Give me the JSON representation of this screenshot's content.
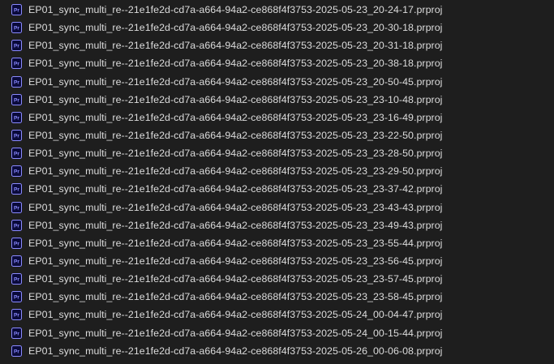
{
  "colors": {
    "background": "#1e1e1e",
    "text": "#dcdcdc",
    "icon_fill": "#0a0a3a",
    "icon_accent": "#8a8aff"
  },
  "icon": {
    "name": "premiere-pro-project-icon",
    "label": "Pr"
  },
  "files": [
    "EP01_sync_multi_re--21e1fe2d-cd7a-a664-94a2-ce868f4f3753-2025-05-23_20-24-17.prproj",
    "EP01_sync_multi_re--21e1fe2d-cd7a-a664-94a2-ce868f4f3753-2025-05-23_20-30-18.prproj",
    "EP01_sync_multi_re--21e1fe2d-cd7a-a664-94a2-ce868f4f3753-2025-05-23_20-31-18.prproj",
    "EP01_sync_multi_re--21e1fe2d-cd7a-a664-94a2-ce868f4f3753-2025-05-23_20-38-18.prproj",
    "EP01_sync_multi_re--21e1fe2d-cd7a-a664-94a2-ce868f4f3753-2025-05-23_20-50-45.prproj",
    "EP01_sync_multi_re--21e1fe2d-cd7a-a664-94a2-ce868f4f3753-2025-05-23_23-10-48.prproj",
    "EP01_sync_multi_re--21e1fe2d-cd7a-a664-94a2-ce868f4f3753-2025-05-23_23-16-49.prproj",
    "EP01_sync_multi_re--21e1fe2d-cd7a-a664-94a2-ce868f4f3753-2025-05-23_23-22-50.prproj",
    "EP01_sync_multi_re--21e1fe2d-cd7a-a664-94a2-ce868f4f3753-2025-05-23_23-28-50.prproj",
    "EP01_sync_multi_re--21e1fe2d-cd7a-a664-94a2-ce868f4f3753-2025-05-23_23-29-50.prproj",
    "EP01_sync_multi_re--21e1fe2d-cd7a-a664-94a2-ce868f4f3753-2025-05-23_23-37-42.prproj",
    "EP01_sync_multi_re--21e1fe2d-cd7a-a664-94a2-ce868f4f3753-2025-05-23_23-43-43.prproj",
    "EP01_sync_multi_re--21e1fe2d-cd7a-a664-94a2-ce868f4f3753-2025-05-23_23-49-43.prproj",
    "EP01_sync_multi_re--21e1fe2d-cd7a-a664-94a2-ce868f4f3753-2025-05-23_23-55-44.prproj",
    "EP01_sync_multi_re--21e1fe2d-cd7a-a664-94a2-ce868f4f3753-2025-05-23_23-56-45.prproj",
    "EP01_sync_multi_re--21e1fe2d-cd7a-a664-94a2-ce868f4f3753-2025-05-23_23-57-45.prproj",
    "EP01_sync_multi_re--21e1fe2d-cd7a-a664-94a2-ce868f4f3753-2025-05-23_23-58-45.prproj",
    "EP01_sync_multi_re--21e1fe2d-cd7a-a664-94a2-ce868f4f3753-2025-05-24_00-04-47.prproj",
    "EP01_sync_multi_re--21e1fe2d-cd7a-a664-94a2-ce868f4f3753-2025-05-24_00-15-44.prproj",
    "EP01_sync_multi_re--21e1fe2d-cd7a-a664-94a2-ce868f4f3753-2025-05-26_00-06-08.prproj"
  ]
}
